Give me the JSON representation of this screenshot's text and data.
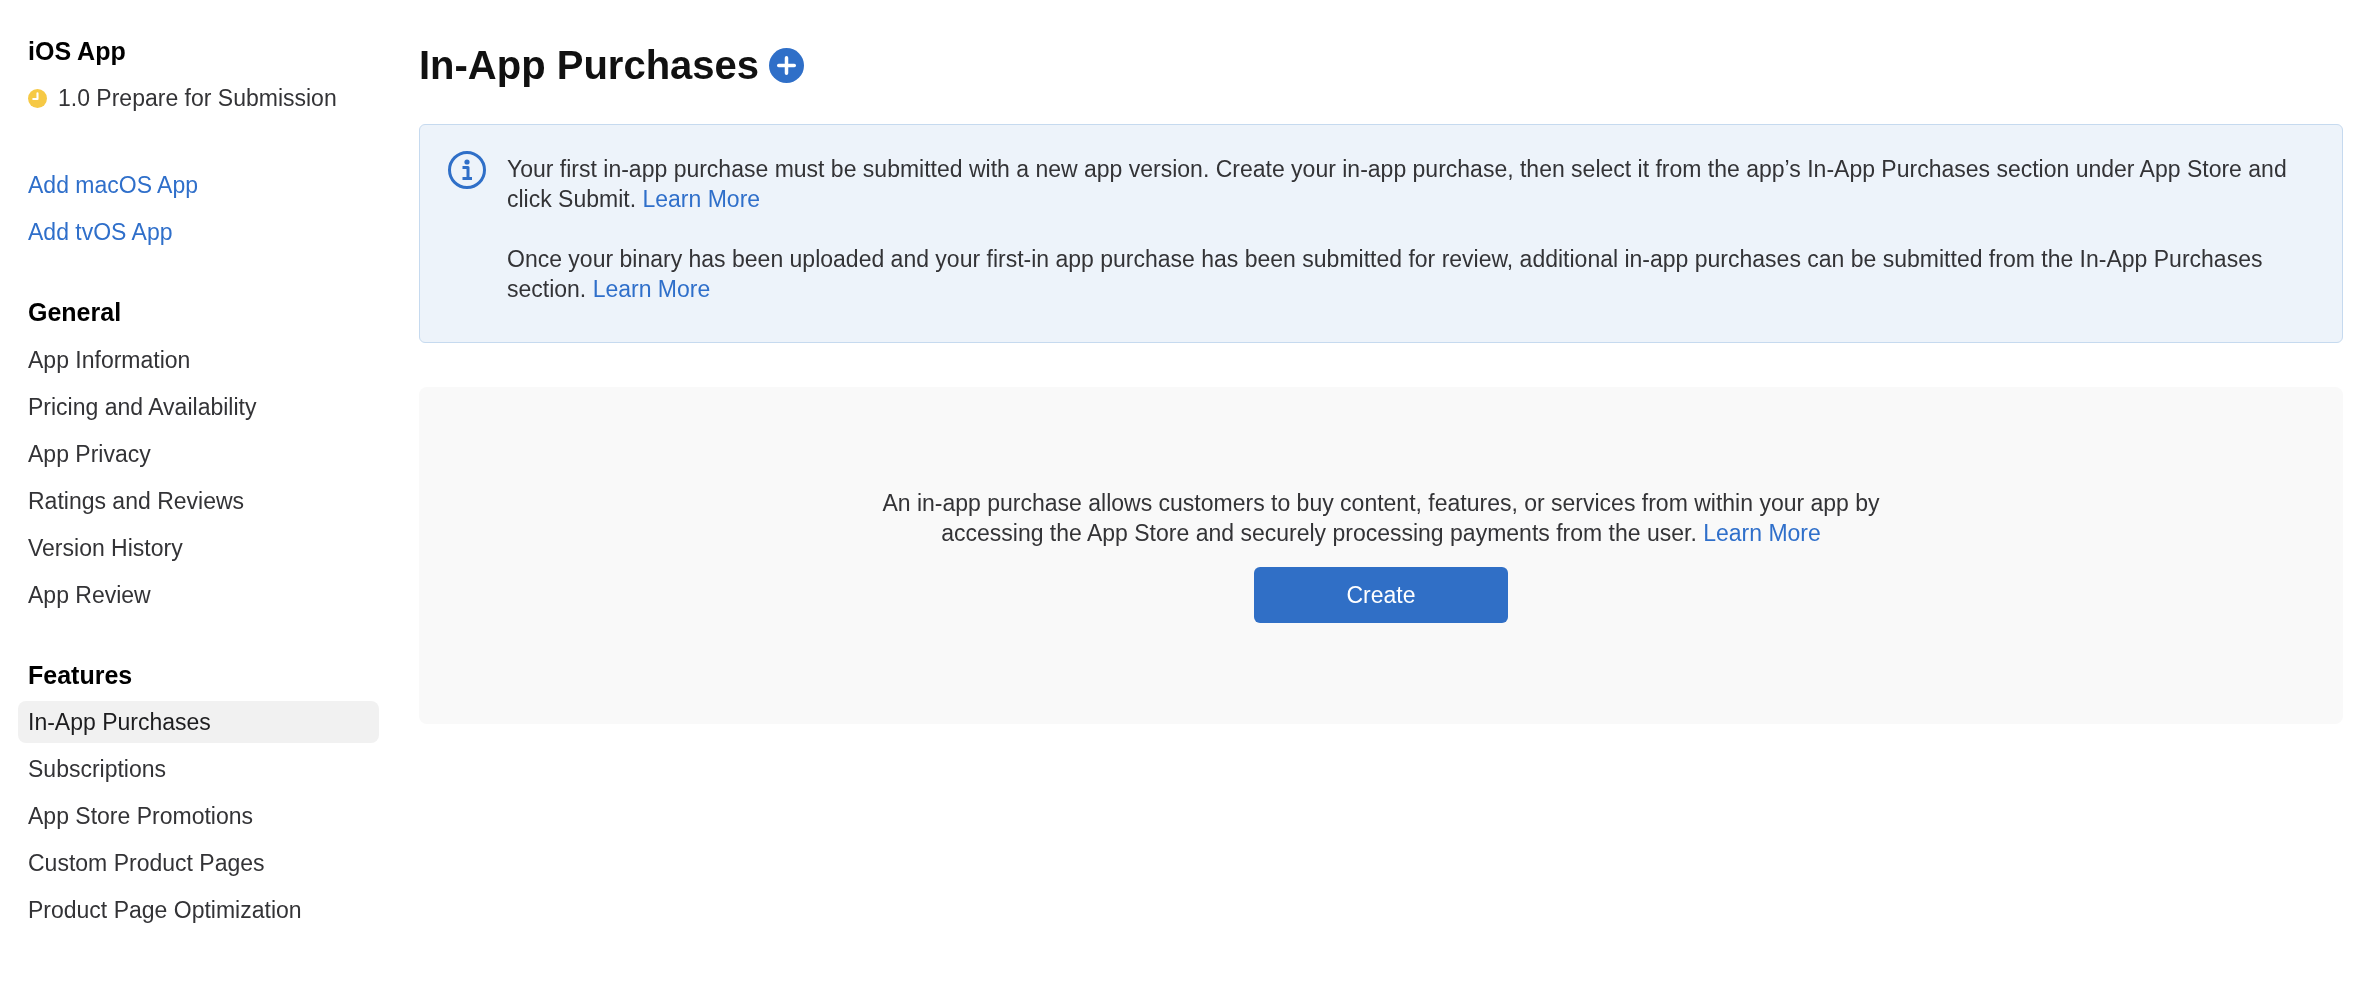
{
  "sidebar": {
    "app": {
      "title": "iOS App",
      "version_status": "1.0 Prepare for Submission"
    },
    "add_links": [
      "Add macOS App",
      "Add tvOS App"
    ],
    "sections": [
      {
        "title": "General",
        "items": [
          {
            "label": "App Information",
            "selected": false
          },
          {
            "label": "Pricing and Availability",
            "selected": false
          },
          {
            "label": "App Privacy",
            "selected": false
          },
          {
            "label": "Ratings and Reviews",
            "selected": false
          },
          {
            "label": "Version History",
            "selected": false
          },
          {
            "label": "App Review",
            "selected": false
          }
        ]
      },
      {
        "title": "Features",
        "items": [
          {
            "label": "In-App Purchases",
            "selected": true
          },
          {
            "label": "Subscriptions",
            "selected": false
          },
          {
            "label": "App Store Promotions",
            "selected": false
          },
          {
            "label": "Custom Product Pages",
            "selected": false
          },
          {
            "label": "Product Page Optimization",
            "selected": false
          }
        ]
      }
    ]
  },
  "main": {
    "title": "In-App Purchases",
    "info_banner": {
      "paragraphs": [
        {
          "text": "Your first in-app purchase must be submitted with a new app version. Create your in-app purchase, then select it from the app’s In-App Purchases section under App Store and click Submit.",
          "link": "Learn More"
        },
        {
          "text": "Once your binary has been uploaded and your first-in app purchase has been submitted for review, additional in-app purchases can be submitted from the In-App Purchases section.",
          "link": "Learn More"
        }
      ]
    },
    "empty_state": {
      "text": "An in-app purchase allows customers to buy content, features, or services from within your app by accessing the App Store and securely processing payments from the user.",
      "link": "Learn More",
      "button": "Create"
    }
  }
}
